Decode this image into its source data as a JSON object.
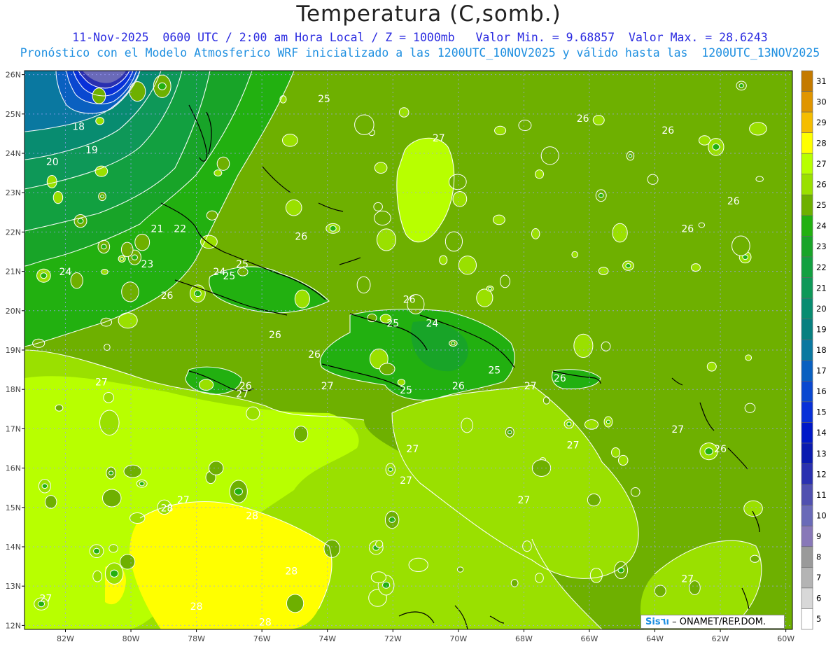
{
  "header": {
    "title": "Temperatura (C,somb.)",
    "subtitle1": "11-Nov-2025  0600 UTC / 2:00 am Hora Local / Z = 1000mb   Valor Min. = 9.68857  Valor Max. = 28.6243",
    "subtitle2": "Pronóstico con el Modelo Atmosferico WRF inicializado a las 1200UTC_10NOV2025 y válido hasta las  1200UTC_13NOV2025"
  },
  "credit": {
    "brand": "Sis٦ı",
    "rest": " – ONAMET/REP.DOM."
  },
  "axes": {
    "lat_labels": [
      "26N",
      "25N",
      "24N",
      "23N",
      "22N",
      "21N",
      "20N",
      "19N",
      "18N",
      "17N",
      "16N",
      "15N",
      "14N",
      "13N",
      "12N"
    ],
    "lon_labels": [
      "82W",
      "80W",
      "78W",
      "76W",
      "74W",
      "72W",
      "70W",
      "68W",
      "66W",
      "64W",
      "62W",
      "60W"
    ]
  },
  "colorbar": {
    "levels": [
      "31",
      "30",
      "29",
      "28",
      "27",
      "26",
      "25",
      "24",
      "23",
      "22",
      "21",
      "20",
      "19",
      "18",
      "17",
      "16",
      "15",
      "14",
      "13",
      "12",
      "11",
      "10",
      "9",
      "8",
      "7",
      "6",
      "5"
    ],
    "colors": [
      "#c47a00",
      "#e09500",
      "#f5bd00",
      "#ffff00",
      "#b8ff00",
      "#9ae000",
      "#6eb000",
      "#22b010",
      "#18a428",
      "#12a040",
      "#0e9858",
      "#088c70",
      "#078080",
      "#0a78a0",
      "#0a60c0",
      "#0a48d0",
      "#0830d8",
      "#0018c8",
      "#0a1ab0",
      "#2a30b0",
      "#5050b0",
      "#6a6ab8",
      "#8878b8",
      "#9a9a9a",
      "#b4b4b4",
      "#d8d8d8",
      "#ffffff"
    ]
  },
  "contour_labels": [
    "18",
    "19",
    "20",
    "21",
    "22",
    "23",
    "24",
    "25",
    "26",
    "27",
    "28",
    "24",
    "25",
    "26",
    "27",
    "28"
  ],
  "map_labels": [
    {
      "t": "18",
      "lon": -81.6,
      "lat": 24.6
    },
    {
      "t": "19",
      "lon": -81.2,
      "lat": 24.0
    },
    {
      "t": "20",
      "lon": -82.4,
      "lat": 23.7
    },
    {
      "t": "21",
      "lon": -79.2,
      "lat": 22.0
    },
    {
      "t": "22",
      "lon": -78.5,
      "lat": 22.0
    },
    {
      "t": "23",
      "lon": -79.5,
      "lat": 21.1
    },
    {
      "t": "24",
      "lon": -82.0,
      "lat": 20.9
    },
    {
      "t": "24",
      "lon": -77.3,
      "lat": 20.9
    },
    {
      "t": "25",
      "lon": -76.6,
      "lat": 21.1
    },
    {
      "t": "25",
      "lon": -77.0,
      "lat": 20.8
    },
    {
      "t": "25",
      "lon": -74.1,
      "lat": 25.3
    },
    {
      "t": "26",
      "lon": -78.9,
      "lat": 20.3
    },
    {
      "t": "26",
      "lon": -74.8,
      "lat": 21.8
    },
    {
      "t": "26",
      "lon": -75.6,
      "lat": 19.3
    },
    {
      "t": "26",
      "lon": -71.5,
      "lat": 20.2
    },
    {
      "t": "24",
      "lon": -70.8,
      "lat": 19.6
    },
    {
      "t": "25",
      "lon": -72.0,
      "lat": 19.6
    },
    {
      "t": "26",
      "lon": -74.4,
      "lat": 18.8
    },
    {
      "t": "25",
      "lon": -68.9,
      "lat": 18.4
    },
    {
      "t": "25",
      "lon": -71.6,
      "lat": 17.9
    },
    {
      "t": "26",
      "lon": -70.0,
      "lat": 18.0
    },
    {
      "t": "26",
      "lon": -66.9,
      "lat": 18.2
    },
    {
      "t": "26",
      "lon": -76.5,
      "lat": 18.0
    },
    {
      "t": "27",
      "lon": -76.6,
      "lat": 17.8
    },
    {
      "t": "27",
      "lon": -74.0,
      "lat": 18.0
    },
    {
      "t": "27",
      "lon": -80.9,
      "lat": 18.1
    },
    {
      "t": "27",
      "lon": -67.8,
      "lat": 18.0
    },
    {
      "t": "27",
      "lon": -71.4,
      "lat": 16.4
    },
    {
      "t": "27",
      "lon": -71.6,
      "lat": 15.6
    },
    {
      "t": "27",
      "lon": -66.5,
      "lat": 16.5
    },
    {
      "t": "27",
      "lon": -68.0,
      "lat": 15.1
    },
    {
      "t": "27",
      "lon": -63.3,
      "lat": 16.9
    },
    {
      "t": "26",
      "lon": -62.0,
      "lat": 16.4
    },
    {
      "t": "27",
      "lon": -70.6,
      "lat": 24.3
    },
    {
      "t": "26",
      "lon": -66.2,
      "lat": 24.8
    },
    {
      "t": "26",
      "lon": -63.6,
      "lat": 24.5
    },
    {
      "t": "26",
      "lon": -61.6,
      "lat": 22.7
    },
    {
      "t": "26",
      "lon": -63.0,
      "lat": 22.0
    },
    {
      "t": "28",
      "lon": -78.9,
      "lat": 14.9
    },
    {
      "t": "27",
      "lon": -78.4,
      "lat": 15.1
    },
    {
      "t": "28",
      "lon": -76.3,
      "lat": 14.7
    },
    {
      "t": "28",
      "lon": -75.1,
      "lat": 13.3
    },
    {
      "t": "28",
      "lon": -78.0,
      "lat": 12.4
    },
    {
      "t": "28",
      "lon": -75.9,
      "lat": 12.0
    },
    {
      "t": "27",
      "lon": -83.4,
      "lat": 12.9
    },
    {
      "t": "27",
      "lon": -82.6,
      "lat": 12.6
    },
    {
      "t": "27",
      "lon": -63.0,
      "lat": 13.1
    }
  ]
}
